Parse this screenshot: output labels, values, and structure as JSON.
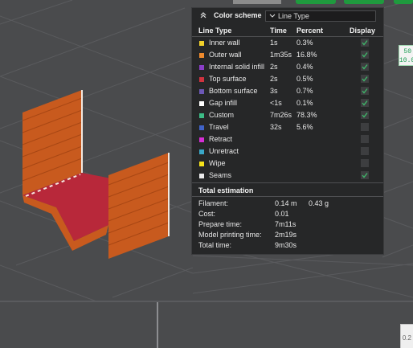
{
  "colors": {
    "inner_wall": "#f2d12b",
    "outer_wall": "#ee8a2d",
    "internal_solid_infill": "#8a3ec7",
    "top_surface": "#d0333f",
    "bottom_surface": "#6c58b6",
    "gap_infill": "#ffffff",
    "custom": "#3cbc86",
    "travel": "#4063c8",
    "retract": "#d62ed6",
    "unretract": "#3aa8c8",
    "wipe": "#f5e21a",
    "seams": "#ebebeb",
    "check": "#3fb569",
    "model_orange": "#c85a1e",
    "model_red": "#b8283a"
  },
  "side_labels": {
    "right_top": "50\n10.0",
    "right_bottom": "0.2"
  },
  "panel": {
    "collapse_icon": "chevron-up-double-icon",
    "title": "Color scheme",
    "selector_value": "Line Type",
    "headers": {
      "type": "Line Type",
      "time": "Time",
      "percent": "Percent",
      "display": "Display"
    },
    "rows": [
      {
        "name": "Inner wall",
        "time": "1s",
        "percent": "0.3%",
        "display": true,
        "color_key": "inner_wall"
      },
      {
        "name": "Outer wall",
        "time": "1m35s",
        "percent": "16.8%",
        "display": true,
        "color_key": "outer_wall"
      },
      {
        "name": "Internal solid infill",
        "time": "2s",
        "percent": "0.4%",
        "display": true,
        "color_key": "internal_solid_infill"
      },
      {
        "name": "Top surface",
        "time": "2s",
        "percent": "0.5%",
        "display": true,
        "color_key": "top_surface"
      },
      {
        "name": "Bottom surface",
        "time": "3s",
        "percent": "0.7%",
        "display": true,
        "color_key": "bottom_surface"
      },
      {
        "name": "Gap infill",
        "time": "<1s",
        "percent": "0.1%",
        "display": true,
        "color_key": "gap_infill"
      },
      {
        "name": "Custom",
        "time": "7m26s",
        "percent": "78.3%",
        "display": true,
        "color_key": "custom"
      },
      {
        "name": "Travel",
        "time": "32s",
        "percent": "5.6%",
        "display": false,
        "color_key": "travel"
      },
      {
        "name": "Retract",
        "time": "",
        "percent": "",
        "display": false,
        "color_key": "retract"
      },
      {
        "name": "Unretract",
        "time": "",
        "percent": "",
        "display": false,
        "color_key": "unretract"
      },
      {
        "name": "Wipe",
        "time": "",
        "percent": "",
        "display": false,
        "color_key": "wipe"
      },
      {
        "name": "Seams",
        "time": "",
        "percent": "",
        "display": true,
        "color_key": "seams"
      }
    ],
    "total_title": "Total estimation",
    "totals": [
      {
        "label": "Filament:",
        "value": "0.14 m",
        "value2": "0.43 g"
      },
      {
        "label": "Cost:",
        "value": "0.01",
        "value2": ""
      },
      {
        "label": "Prepare time:",
        "value": "7m11s",
        "value2": ""
      },
      {
        "label": "Model printing time:",
        "value": "2m19s",
        "value2": ""
      },
      {
        "label": "Total time:",
        "value": "9m30s",
        "value2": ""
      }
    ]
  }
}
